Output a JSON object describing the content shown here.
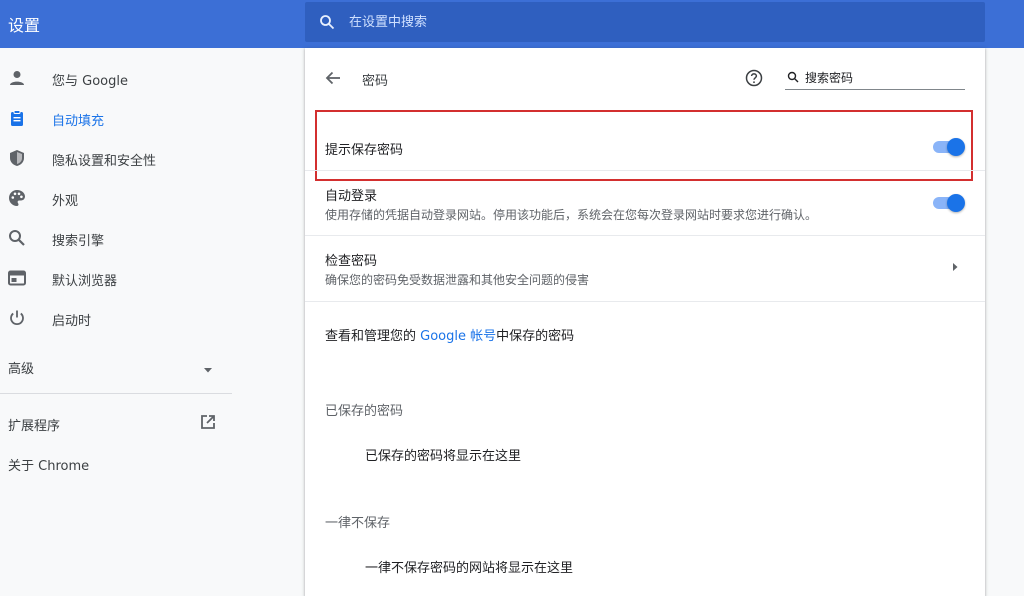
{
  "header": {
    "title": "设置",
    "search_placeholder": "在设置中搜索"
  },
  "sidebar": {
    "items": [
      {
        "label": "您与 Google",
        "icon": "person-icon",
        "active": false
      },
      {
        "label": "自动填充",
        "icon": "clipboard-icon",
        "active": true
      },
      {
        "label": "隐私设置和安全性",
        "icon": "shield-icon",
        "active": false
      },
      {
        "label": "外观",
        "icon": "palette-icon",
        "active": false
      },
      {
        "label": "搜索引擎",
        "icon": "search-icon",
        "active": false
      },
      {
        "label": "默认浏览器",
        "icon": "browser-icon",
        "active": false
      },
      {
        "label": "启动时",
        "icon": "power-icon",
        "active": false
      }
    ],
    "advanced_label": "高级",
    "extensions_label": "扩展程序",
    "about_label": "关于 Chrome"
  },
  "passwords": {
    "title": "密码",
    "search_placeholder": "搜索密码",
    "offer_to_save": {
      "label": "提示保存密码",
      "enabled": true
    },
    "auto_signin": {
      "label": "自动登录",
      "description": "使用存储的凭据自动登录网站。停用该功能后，系统会在您每次登录网站时要求您进行确认。",
      "enabled": true
    },
    "check_passwords": {
      "label": "检查密码",
      "description": "确保您的密码免受数据泄露和其他安全问题的侵害"
    },
    "manage_prefix": "查看和管理您的 ",
    "manage_link": "Google 帐号",
    "manage_suffix": "中保存的密码",
    "saved_heading": "已保存的密码",
    "saved_empty": "已保存的密码将显示在这里",
    "never_heading": "一律不保存",
    "never_empty": "一律不保存密码的网站将显示在这里"
  },
  "colors": {
    "header_bg": "#3c6fd6",
    "accent": "#1a73e8",
    "highlight_border": "#d32f2f"
  }
}
